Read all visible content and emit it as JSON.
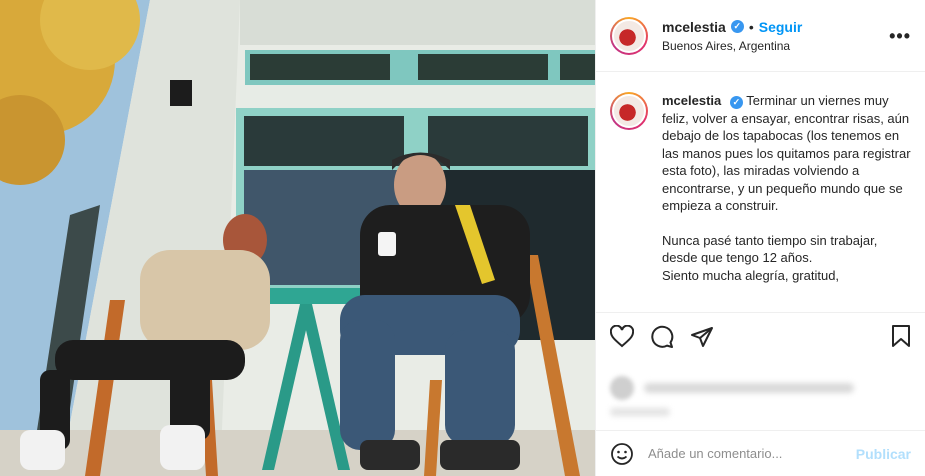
{
  "post": {
    "username": "mcelestia",
    "verified_icon": "verified-badge-icon",
    "follow_label": "Seguir",
    "separator": "•",
    "location": "Buenos Aires, Argentina",
    "more_icon": "more-options-icon"
  },
  "caption": {
    "username": "mcelestia",
    "paragraph1": "Terminar un viernes muy feliz, volver a ensayar, encontrar risas, aún debajo de los tapabocas (los tenemos en las manos pues los quitamos para registrar esta foto), las miradas volviendo a encontrarse, y un pequeño mundo que se empieza a construir.",
    "paragraph2_line1": "Nunca pasé tanto tiempo sin trabajar, desde que tengo 12 años.",
    "paragraph2_line2": "Siento mucha alegría, gratitud,"
  },
  "actions": {
    "like_icon": "heart-icon",
    "comment_icon": "comment-bubble-icon",
    "share_icon": "paper-plane-icon",
    "save_icon": "bookmark-icon"
  },
  "comment_box": {
    "emoji_icon": "smiley-icon",
    "placeholder": "Añade un comentario...",
    "publish_label": "Publicar"
  },
  "colors": {
    "accent": "#0095f6",
    "publish_disabled": "#b2dffc",
    "verified": "#3897f0"
  }
}
